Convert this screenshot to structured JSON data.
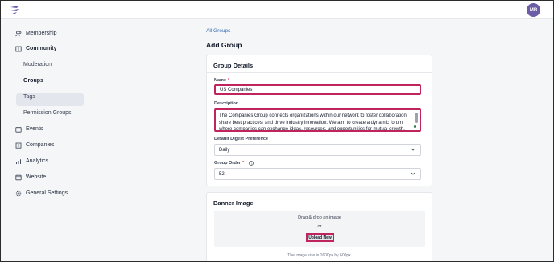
{
  "user": {
    "initials": "MR"
  },
  "colors": {
    "accent": "#6b5ca5",
    "highlight": "#c0245c",
    "link": "#3a6fb0"
  },
  "sidebar": {
    "items": [
      {
        "label": "Membership",
        "icon": "users-icon"
      },
      {
        "label": "Community",
        "icon": "book-icon"
      },
      {
        "label": "Events",
        "icon": "calendar-icon"
      },
      {
        "label": "Companies",
        "icon": "building-icon"
      },
      {
        "label": "Analytics",
        "icon": "chart-icon"
      },
      {
        "label": "Website",
        "icon": "browser-icon"
      },
      {
        "label": "General Settings",
        "icon": "gear-icon"
      }
    ],
    "community_sub": [
      "Moderation",
      "Groups",
      "Tags",
      "Permission Groups"
    ],
    "active_sub": "Groups"
  },
  "breadcrumb": "All Groups",
  "page_title": "Add Group",
  "details": {
    "title": "Group Details",
    "name_label": "Name",
    "name_required": "*",
    "name_value": "US Companies",
    "description_label": "Description",
    "description_value": "The Companies Group connects organizations within our network to foster collaboration, share best practices, and drive industry innovation. We aim to create a dynamic forum where companies can exchange ideas, resources, and opportunities for mutual growth.",
    "digest_label": "Default Digest Preference",
    "digest_value": "Daily",
    "order_label": "Group Order",
    "order_required": "*",
    "order_value": "52"
  },
  "banner": {
    "title": "Banner Image",
    "drag_text": "Drag & drop an image",
    "or_text": "or",
    "upload_label": "Upload New",
    "hint": "The image size is 1600px by 600px"
  }
}
